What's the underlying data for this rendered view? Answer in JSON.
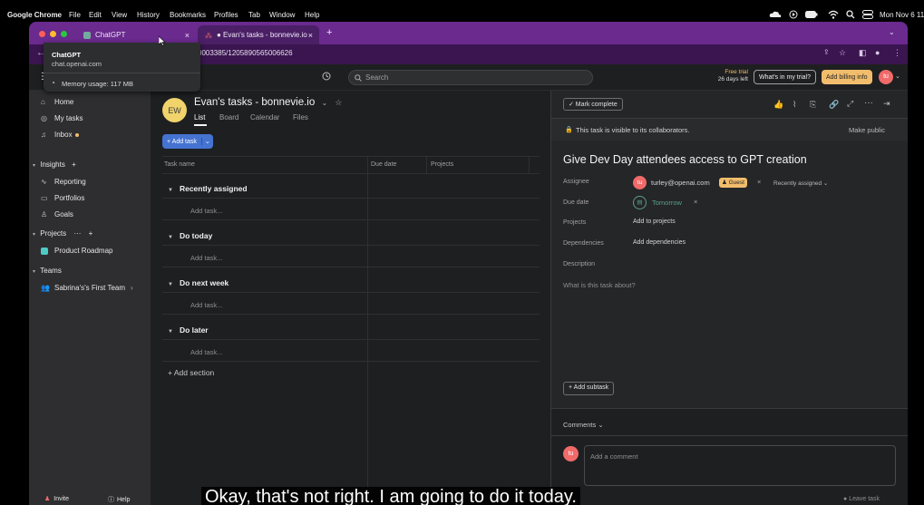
{
  "menubar": {
    "app_name": "Google Chrome",
    "menus": [
      "File",
      "Edit",
      "View",
      "History",
      "Bookmarks",
      "Profiles",
      "Tab",
      "Window",
      "Help"
    ],
    "clock": "Mon Nov 6 11"
  },
  "browser": {
    "tabs": [
      {
        "title": "ChatGPT",
        "close": "×"
      },
      {
        "title": "● Evan's tasks - bonnevie.io",
        "close": "×"
      }
    ],
    "new_tab": "+",
    "url_prefix": "C",
    "url": "0003385/1205890565006626",
    "hover_card": {
      "title": "ChatGPT",
      "domain": "chat.openai.com",
      "memory": "Memory usage: 117 MB"
    }
  },
  "topbar": {
    "search_placeholder": "Search",
    "trial_line1": "Free trial",
    "trial_line2": "26 days left",
    "whats_in_trial": "What's in my trial?",
    "add_billing": "Add billing info",
    "user_initials": "tu"
  },
  "sidebar": {
    "nav": [
      {
        "label": "Home",
        "icon": "home-icon"
      },
      {
        "label": "My tasks",
        "icon": "check-circle-icon"
      },
      {
        "label": "Inbox",
        "icon": "bell-icon"
      }
    ],
    "insights_header": "Insights",
    "insights": [
      {
        "label": "Reporting",
        "icon": "chart-line-icon"
      },
      {
        "label": "Portfolios",
        "icon": "folder-icon"
      },
      {
        "label": "Goals",
        "icon": "user-target-icon"
      }
    ],
    "projects_header": "Projects",
    "projects": [
      {
        "label": "Product Roadmap",
        "color": "#4ecbc4"
      }
    ],
    "teams_header": "Teams",
    "teams": [
      {
        "label": "Sabrina's's First Team"
      }
    ],
    "invite": "Invite",
    "help": "Help"
  },
  "project": {
    "avatar": "EW",
    "title": "Evan's tasks - bonnevie.io",
    "tabs": [
      "List",
      "Board",
      "Calendar",
      "Files"
    ],
    "add_task_button": "+ Add task",
    "columns": [
      "Task name",
      "Due date",
      "Projects"
    ],
    "sections": [
      {
        "name": "Recently assigned",
        "add_task": "Add task..."
      },
      {
        "name": "Do today",
        "add_task": "Add task..."
      },
      {
        "name": "Do next week",
        "add_task": "Add task..."
      },
      {
        "name": "Do later",
        "add_task": "Add task..."
      }
    ],
    "add_section": "+ Add section"
  },
  "task_detail": {
    "mark_complete": "✓ Mark complete",
    "visibility_notice": "This task is visible to its collaborators.",
    "make_public": "Make public",
    "title": "Give Dev Day attendees access to GPT creation",
    "fields": {
      "assignee_label": "Assignee",
      "assignee_initials": "tu",
      "assignee_email": "turley@openai.com",
      "guest_badge": "Guest",
      "recently_assigned": "Recently assigned",
      "due_label": "Due date",
      "due_value": "Tomorrow",
      "projects_label": "Projects",
      "projects_value": "Add to projects",
      "dependencies_label": "Dependencies",
      "dependencies_value": "Add dependencies",
      "description_label": "Description",
      "description_placeholder": "What is this task about?"
    },
    "add_subtask": "+ Add subtask",
    "comments_header": "Comments",
    "comment_initials": "tu",
    "comment_placeholder": "Add a comment",
    "leave_task": "Leave task"
  },
  "caption": "Okay, that's not right. I am going to do it today.",
  "colors": {
    "tabstrip": "#6a2a8e",
    "accent_blue": "#4573d2",
    "billing_orange": "#f1bd6c",
    "avatar_pink": "#f06a6a",
    "guest_badge": "#f1bd6c"
  }
}
